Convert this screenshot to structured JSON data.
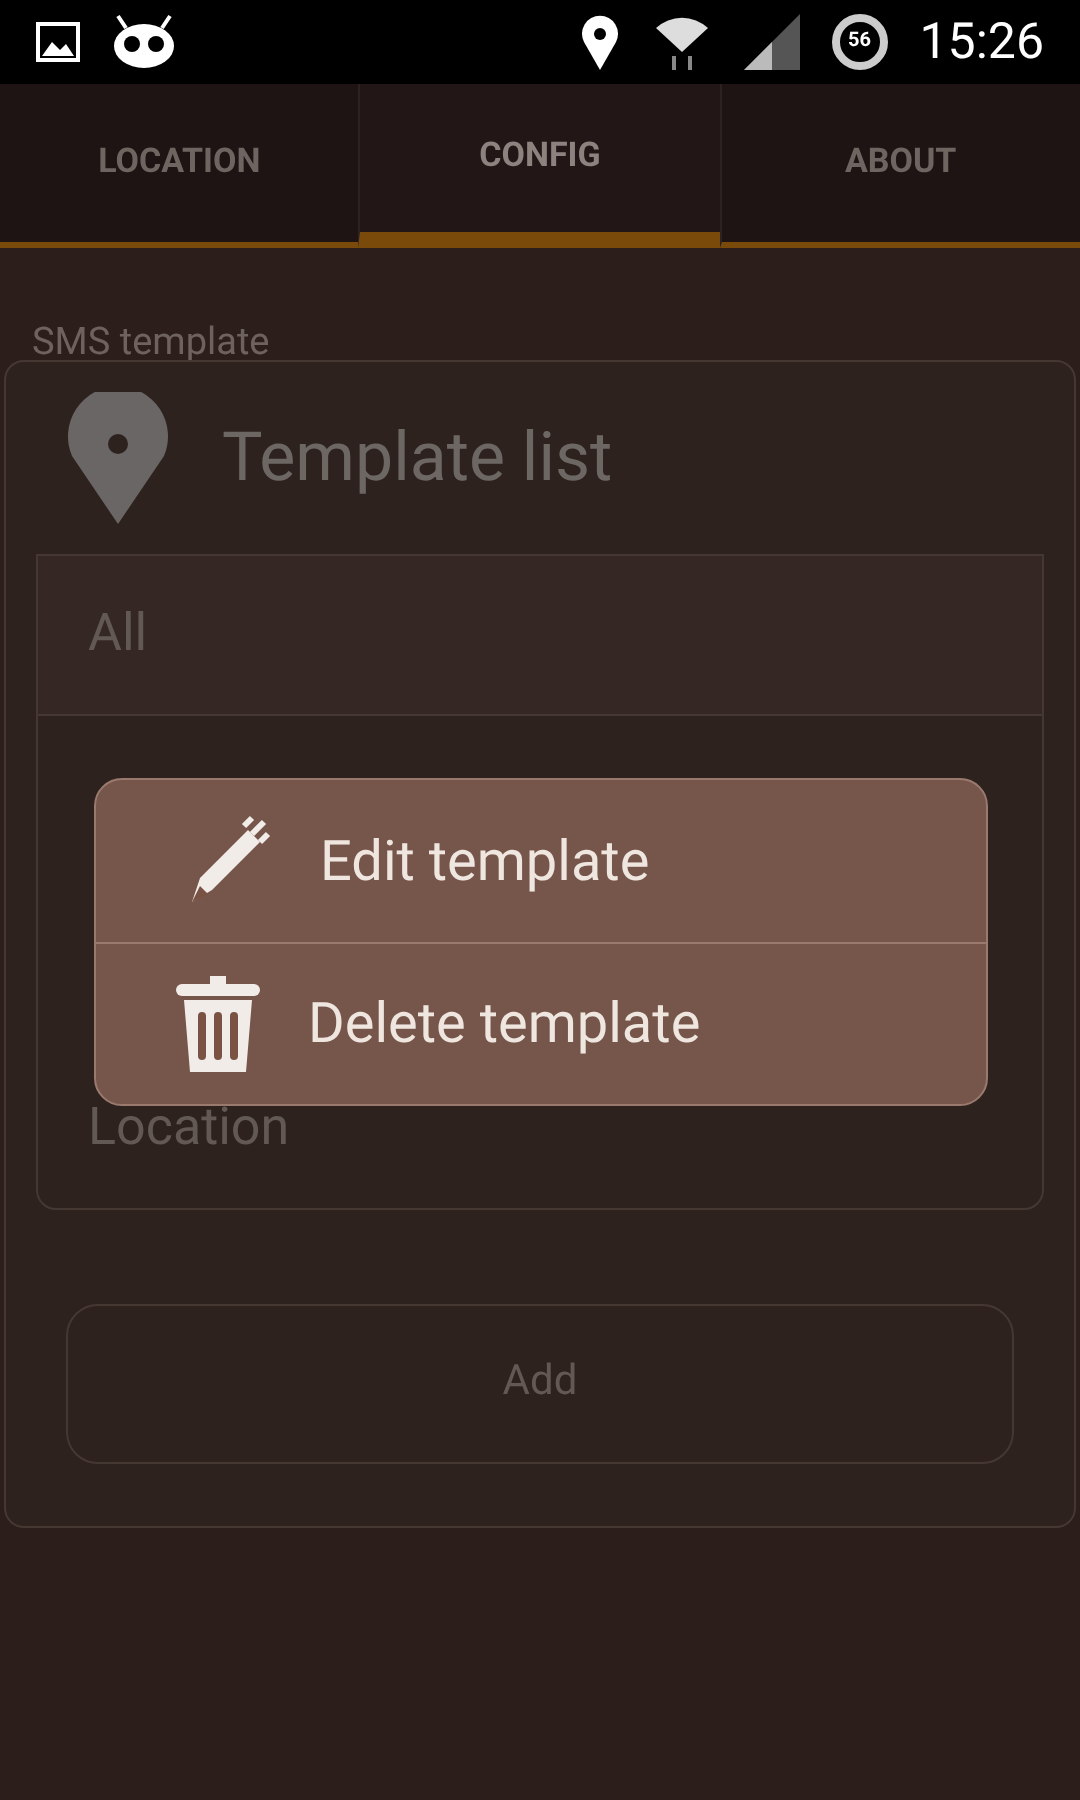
{
  "status_bar": {
    "battery": "56",
    "time": "15:26"
  },
  "tabs": [
    {
      "label": "LOCATION",
      "selected": false
    },
    {
      "label": "CONFIG",
      "selected": true
    },
    {
      "label": "ABOUT",
      "selected": false
    }
  ],
  "section_label": "SMS template",
  "dialog": {
    "title": "Template list",
    "items": [
      {
        "label": "All",
        "selected": true
      },
      {
        "label": "Location",
        "selected": false
      }
    ],
    "add_button": "Add"
  },
  "context_menu": [
    {
      "kind": "edit",
      "label": "Edit template"
    },
    {
      "kind": "delete",
      "label": "Delete template"
    }
  ]
}
